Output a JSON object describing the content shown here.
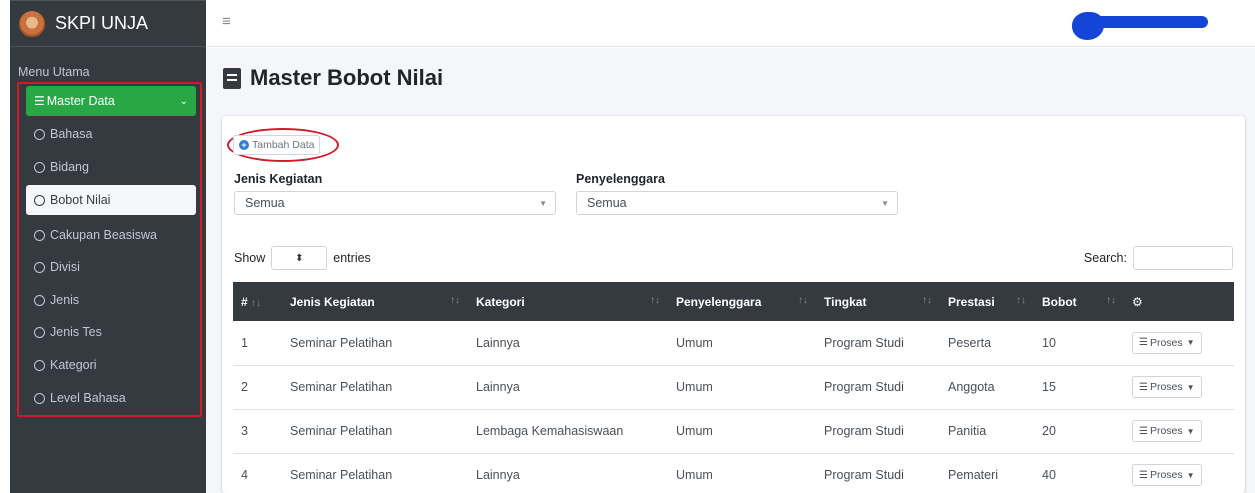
{
  "brand": {
    "name": "SKPI UNJA"
  },
  "sidebar": {
    "header": "Menu Utama",
    "master": {
      "label": "Master Data",
      "icon": "list-icon",
      "expand_icon": "chevron-down-icon"
    },
    "items": [
      {
        "label": "Bahasa",
        "active": false
      },
      {
        "label": "Bidang",
        "active": false
      },
      {
        "label": "Bobot Nilai",
        "active": true
      },
      {
        "label": "Cakupan Beasiswa",
        "active": false
      },
      {
        "label": "Divisi",
        "active": false
      },
      {
        "label": "Jenis",
        "active": false
      },
      {
        "label": "Jenis Tes",
        "active": false
      },
      {
        "label": "Kategori",
        "active": false
      },
      {
        "label": "Level Bahasa",
        "active": false
      }
    ]
  },
  "navbar": {
    "menu_icon": "hamburger-icon"
  },
  "page": {
    "title": "Master Bobot Nilai",
    "add_button": "Tambah Data",
    "filters": {
      "jenis_label": "Jenis Kegiatan",
      "jenis_value": "Semua",
      "penyelenggara_label": "Penyelenggara",
      "penyelenggara_value": "Semua"
    },
    "show_label": "Show",
    "entries_label": "entries",
    "search_label": "Search:"
  },
  "table": {
    "columns": [
      "#",
      "Jenis Kegiatan",
      "Kategori",
      "Penyelenggara",
      "Tingkat",
      "Prestasi",
      "Bobot"
    ],
    "action_label": "Proses",
    "rows": [
      {
        "no": "1",
        "jenis": "Seminar Pelatihan",
        "kategori": "Lainnya",
        "penyelenggara": "Umum",
        "tingkat": "Program Studi",
        "prestasi": "Peserta",
        "bobot": "10"
      },
      {
        "no": "2",
        "jenis": "Seminar Pelatihan",
        "kategori": "Lainnya",
        "penyelenggara": "Umum",
        "tingkat": "Program Studi",
        "prestasi": "Anggota",
        "bobot": "15"
      },
      {
        "no": "3",
        "jenis": "Seminar Pelatihan",
        "kategori": "Lembaga Kemahasiswaan",
        "penyelenggara": "Umum",
        "tingkat": "Program Studi",
        "prestasi": "Panitia",
        "bobot": "20"
      },
      {
        "no": "4",
        "jenis": "Seminar Pelatihan",
        "kategori": "Lainnya",
        "penyelenggara": "Umum",
        "tingkat": "Program Studi",
        "prestasi": "Pemateri",
        "bobot": "40"
      }
    ]
  },
  "colors": {
    "sidebar_bg": "#343a40",
    "accent_green": "#28a745",
    "highlight_red": "#d11a2a",
    "content_bg": "#f4f6f9"
  }
}
